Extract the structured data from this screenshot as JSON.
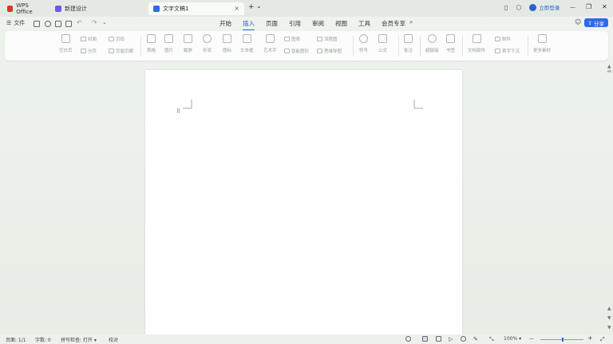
{
  "titlebar": {
    "tabs": [
      {
        "label": "WPS Office",
        "icon": "wps-logo-icon",
        "color": "#e2332b"
      },
      {
        "label": "新建设计",
        "icon": "design-icon",
        "color": "#6b5be6"
      },
      {
        "label": "文字文稿1",
        "icon": "word-doc-icon",
        "color": "#2f6ae8",
        "active": true
      }
    ],
    "new_tab": "+",
    "tab_menu": "⌄",
    "login_label": "立即登录",
    "win_min": "—",
    "win_max": "❐",
    "win_close": "✕"
  },
  "quickbar": {
    "file_label": "文件",
    "menu_icon": "☰",
    "undo": "↶",
    "redo": "↷"
  },
  "menu": {
    "tabs": [
      "开始",
      "插入",
      "页面",
      "引用",
      "审阅",
      "视图",
      "工具",
      "会员专享"
    ],
    "active": "插入"
  },
  "share_label": "分享",
  "ribbon": {
    "large": [
      {
        "label": "空白页",
        "name": "blank-page"
      },
      {
        "label": "表格",
        "name": "table"
      },
      {
        "label": "图片",
        "name": "picture"
      },
      {
        "label": "截屏",
        "name": "screenshot"
      },
      {
        "label": "形状",
        "name": "shape"
      },
      {
        "label": "图标",
        "name": "icon-lib"
      },
      {
        "label": "文本框",
        "name": "textbox"
      },
      {
        "label": "艺术字",
        "name": "wordart"
      },
      {
        "label": "符号",
        "name": "symbol"
      },
      {
        "label": "公式",
        "name": "formula"
      },
      {
        "label": "批注",
        "name": "comment"
      },
      {
        "label": "超链接",
        "name": "hyperlink"
      },
      {
        "label": "书签",
        "name": "bookmark"
      },
      {
        "label": "文档部件",
        "name": "doc-parts"
      },
      {
        "label": "更多素材",
        "name": "more-material"
      }
    ],
    "small": [
      {
        "label": "封面",
        "name": "cover"
      },
      {
        "label": "页码",
        "name": "page-number"
      },
      {
        "label": "分页",
        "name": "page-break"
      },
      {
        "label": "页眉页脚",
        "name": "header-footer"
      },
      {
        "label": "图表",
        "name": "chart"
      },
      {
        "label": "智能图形",
        "name": "smart-graphic"
      },
      {
        "label": "流程图",
        "name": "flowchart"
      },
      {
        "label": "思维导图",
        "name": "mindmap"
      },
      {
        "label": "附件",
        "name": "attachment"
      },
      {
        "label": "首字下沉",
        "name": "drop-cap"
      }
    ]
  },
  "status": {
    "page": "页面: 1/1",
    "words": "字数: 0",
    "spellcheck": "拼写检查: 打开",
    "proofread": "校对",
    "zoom": "100%",
    "zoom_minus": "—",
    "zoom_plus": "+"
  },
  "document": {
    "handle": "⠿"
  }
}
